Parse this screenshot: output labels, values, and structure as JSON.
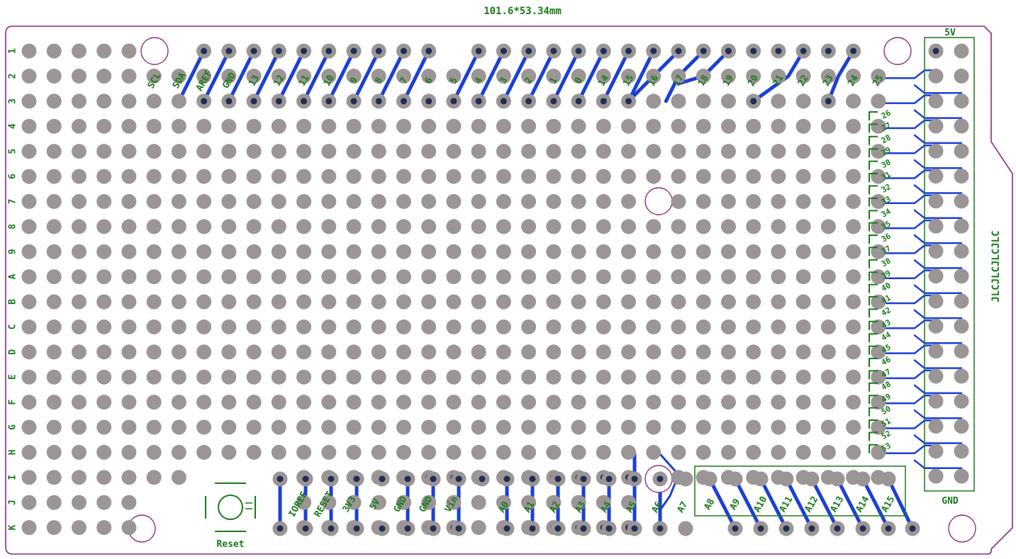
{
  "board": {
    "dimensions": "101.6*53.34mm",
    "jlc_text": "JLCJLCJLCJLC",
    "reset_label": "Reset",
    "header_5v": "5V",
    "header_gnd": "GND",
    "colors": {
      "outline": "#8a2a8a",
      "silk": "#1a7a1a",
      "trace": "#1c3fd6",
      "pad": "#9b9595",
      "pad_dark": "#1d2f55"
    }
  },
  "row_labels": [
    "1",
    "2",
    "3",
    "4",
    "5",
    "6",
    "7",
    "8",
    "9",
    "A",
    "B",
    "C",
    "D",
    "E",
    "F",
    "G",
    "H",
    "I",
    "J",
    "K"
  ],
  "top_labels": [
    "SCL",
    "SDA",
    "AREF",
    "GND",
    "13",
    "12",
    "11",
    "10",
    "9",
    "8",
    "7",
    "6",
    "5",
    "4",
    "3",
    "2",
    "1",
    "0",
    "14",
    "15",
    "16",
    "17",
    "18",
    "19",
    "20",
    "21",
    "22",
    "23",
    "24",
    "25"
  ],
  "right_labels": [
    "26",
    "27",
    "28",
    "29",
    "30",
    "31",
    "32",
    "33",
    "34",
    "35",
    "36",
    "37",
    "38",
    "39",
    "40",
    "41",
    "42",
    "43",
    "44",
    "45",
    "46",
    "47",
    "48",
    "49",
    "50",
    "51",
    "52",
    "53"
  ],
  "bottom_power_labels": [
    "IOREF",
    "RESET",
    "3V3",
    "5V",
    "GND",
    "GND",
    "Vin"
  ],
  "bottom_analog_labels": [
    "A0",
    "A1",
    "A2",
    "A3",
    "A4",
    "A5",
    "A6",
    "A7"
  ],
  "bottom_analog2_labels": [
    "A8",
    "A9",
    "A10",
    "A11",
    "A12",
    "A13",
    "A14",
    "A15"
  ]
}
